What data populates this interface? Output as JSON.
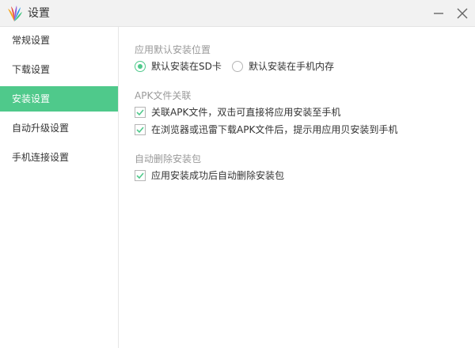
{
  "window": {
    "title": "设置",
    "accent_color": "#4fc98b",
    "logo_icon": "app-logo",
    "minimize_icon": "minimize-icon",
    "close_icon": "close-icon"
  },
  "sidebar": {
    "items": [
      {
        "label": "常规设置",
        "active": false
      },
      {
        "label": "下载设置",
        "active": false
      },
      {
        "label": "安装设置",
        "active": true
      },
      {
        "label": "自动升级设置",
        "active": false
      },
      {
        "label": "手机连接设置",
        "active": false
      }
    ]
  },
  "install_location": {
    "title": "应用默认安装位置",
    "options": [
      {
        "label": "默认安装在SD卡",
        "selected": true
      },
      {
        "label": "默认安装在手机内存",
        "selected": false
      }
    ]
  },
  "apk_association": {
    "title": "APK文件关联",
    "options": [
      {
        "label": "关联APK文件，双击可直接将应用安装至手机",
        "checked": true
      },
      {
        "label": "在浏览器或迅雷下载APK文件后，提示用应用贝安装到手机",
        "checked": true
      }
    ]
  },
  "auto_delete": {
    "title": "自动删除安装包",
    "options": [
      {
        "label": "应用安装成功后自动删除安装包",
        "checked": true
      }
    ]
  }
}
